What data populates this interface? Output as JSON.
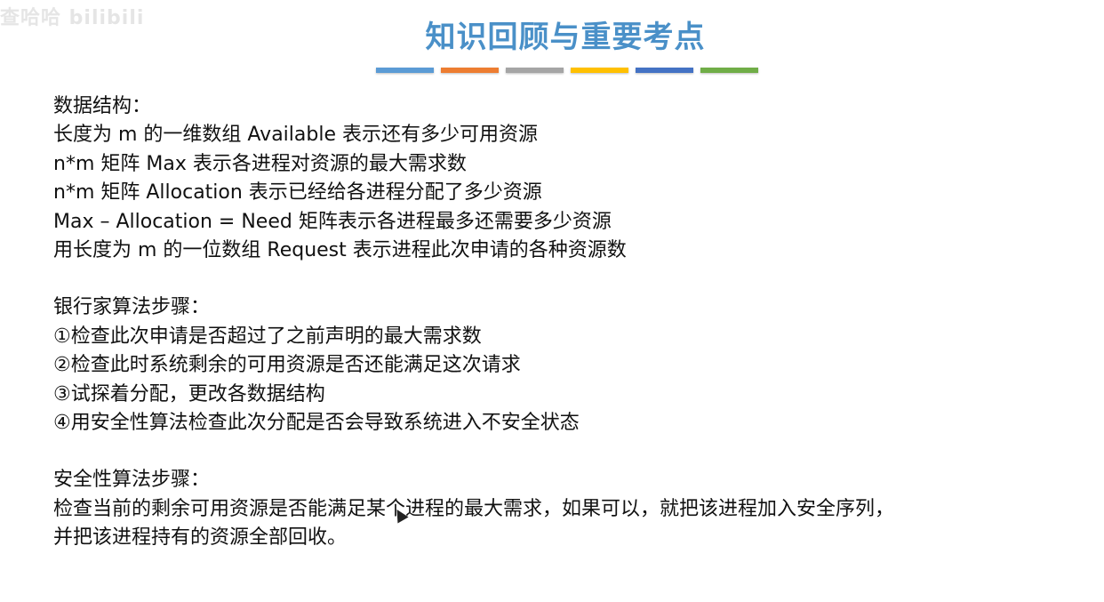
{
  "watermark": "查哈哈 bilibili",
  "title": "知识回顾与重要考点",
  "color_bar": [
    "#5b9bd5",
    "#ed7d31",
    "#a5a5a5",
    "#ffc000",
    "#4472c4",
    "#70ad47"
  ],
  "data_structures": {
    "heading": "数据结构：",
    "lines": [
      "长度为 m 的一维数组 Available 表示还有多少可用资源",
      "n*m 矩阵 Max 表示各进程对资源的最大需求数",
      "n*m 矩阵 Allocation 表示已经给各进程分配了多少资源",
      "Max – Allocation = Need 矩阵表示各进程最多还需要多少资源",
      "用长度为 m 的一位数组 Request 表示进程此次申请的各种资源数"
    ]
  },
  "banker_steps": {
    "heading": "银行家算法步骤：",
    "lines": [
      "①检查此次申请是否超过了之前声明的最大需求数",
      "②检查此时系统剩余的可用资源是否还能满足这次请求",
      "③试探着分配，更改各数据结构",
      "④用安全性算法检查此次分配是否会导致系统进入不安全状态"
    ]
  },
  "safety_steps": {
    "heading": "安全性算法步骤：",
    "lines": [
      "检查当前的剩余可用资源是否能满足某个进程的最大需求，如果可以，就把该进程加入安全序列，",
      "并把该进程持有的资源全部回收。"
    ]
  }
}
